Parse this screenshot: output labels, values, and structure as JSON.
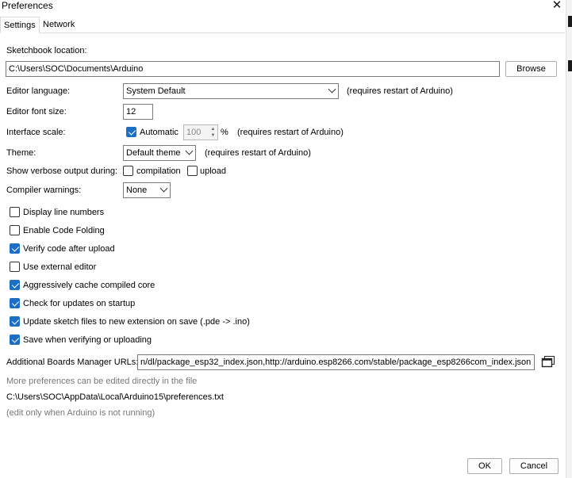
{
  "window": {
    "title": "Preferences"
  },
  "tabs": [
    {
      "label": "Settings"
    },
    {
      "label": "Network"
    }
  ],
  "sketchbook": {
    "label": "Sketchbook location:",
    "value": "C:\\Users\\SOC\\Documents\\Arduino",
    "browse_label": "Browse"
  },
  "editor_language": {
    "label": "Editor language:",
    "value": "System Default",
    "note": "(requires restart of Arduino)"
  },
  "font_size": {
    "label": "Editor font size:",
    "value": "12"
  },
  "interface_scale": {
    "label": "Interface scale:",
    "automatic_label": "Automatic",
    "automatic_checked": true,
    "value": "100",
    "unit": "%",
    "note": "(requires restart of Arduino)"
  },
  "theme": {
    "label": "Theme:",
    "value": "Default theme",
    "note": "(requires restart of Arduino)"
  },
  "verbose": {
    "label": "Show verbose output during:",
    "compilation_label": "compilation",
    "compilation_checked": false,
    "upload_label": "upload",
    "upload_checked": false
  },
  "compiler_warnings": {
    "label": "Compiler warnings:",
    "value": "None"
  },
  "options": [
    {
      "label": "Display line numbers",
      "checked": false
    },
    {
      "label": "Enable Code Folding",
      "checked": false
    },
    {
      "label": "Verify code after upload",
      "checked": true
    },
    {
      "label": "Use external editor",
      "checked": false
    },
    {
      "label": "Aggressively cache compiled core",
      "checked": true
    },
    {
      "label": "Check for updates on startup",
      "checked": true
    },
    {
      "label": "Update sketch files to new extension on save (.pde -> .ino)",
      "checked": true
    },
    {
      "label": "Save when verifying or uploading",
      "checked": true
    }
  ],
  "boards_manager": {
    "label": "Additional Boards Manager URLs:",
    "value": "n/dl/package_esp32_index.json,http://arduino.esp8266.com/stable/package_esp8266com_index.json",
    "button_icon": "window-copy-icon"
  },
  "footer": {
    "more_info": "More preferences can be edited directly in the file",
    "path": "C:\\Users\\SOC\\AppData\\Local\\Arduino15\\preferences.txt",
    "note": "(edit only when Arduino is not running)"
  },
  "actions": {
    "ok_label": "OK",
    "cancel_label": "Cancel"
  },
  "colors": {
    "accent": "#1c6fc4",
    "border": "#7a7a7a",
    "muted_text": "#777777"
  }
}
